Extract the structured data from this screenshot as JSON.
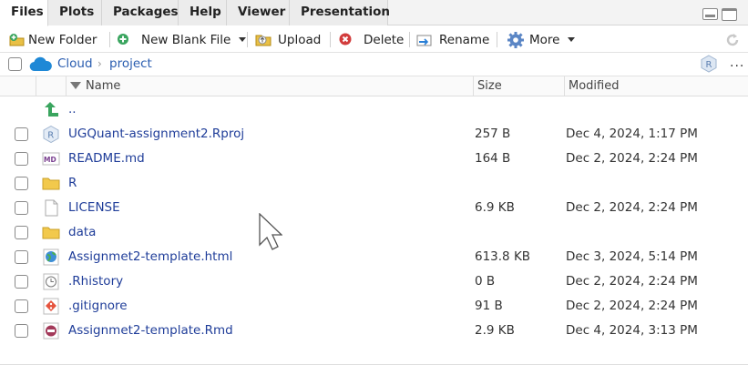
{
  "tabs": [
    {
      "label": "Files",
      "active": true
    },
    {
      "label": "Plots"
    },
    {
      "label": "Packages"
    },
    {
      "label": "Help"
    },
    {
      "label": "Viewer"
    },
    {
      "label": "Presentation"
    }
  ],
  "toolbar": {
    "new_folder": "New Folder",
    "new_blank_file": "New Blank File",
    "upload": "Upload",
    "delete": "Delete",
    "rename": "Rename",
    "more": "More"
  },
  "breadcrumb": {
    "root": "Cloud",
    "current": "project",
    "more": "..."
  },
  "columns": {
    "name": "Name",
    "size": "Size",
    "modified": "Modified"
  },
  "files": [
    {
      "name": "..",
      "icon": "up-arrow-icon",
      "size": "",
      "modified": ""
    },
    {
      "name": "UGQuant-assignment2.Rproj",
      "icon": "rproj-icon",
      "size": "257 B",
      "modified": "Dec 4, 2024, 1:17 PM"
    },
    {
      "name": "README.md",
      "icon": "markdown-icon",
      "size": "164 B",
      "modified": "Dec 2, 2024, 2:24 PM"
    },
    {
      "name": "R",
      "icon": "folder-icon",
      "size": "",
      "modified": ""
    },
    {
      "name": "LICENSE",
      "icon": "text-file-icon",
      "size": "6.9 KB",
      "modified": "Dec 2, 2024, 2:24 PM"
    },
    {
      "name": "data",
      "icon": "folder-icon",
      "size": "",
      "modified": ""
    },
    {
      "name": "Assignmet2-template.html",
      "icon": "html-globe-icon",
      "size": "613.8 KB",
      "modified": "Dec 3, 2024, 5:14 PM"
    },
    {
      "name": ".Rhistory",
      "icon": "history-icon",
      "size": "0 B",
      "modified": "Dec 2, 2024, 2:24 PM"
    },
    {
      "name": ".gitignore",
      "icon": "git-icon",
      "size": "91 B",
      "modified": "Dec 2, 2024, 2:24 PM"
    },
    {
      "name": "Assignmet2-template.Rmd",
      "icon": "rmd-icon",
      "size": "2.9 KB",
      "modified": "Dec 4, 2024, 3:13 PM"
    }
  ],
  "colors": {
    "link": "#1f3d99",
    "breadcrumb": "#2a5db0",
    "folder": "#f2c94c",
    "up_arrow": "#3aa55f",
    "cloud": "#1e88d6"
  }
}
